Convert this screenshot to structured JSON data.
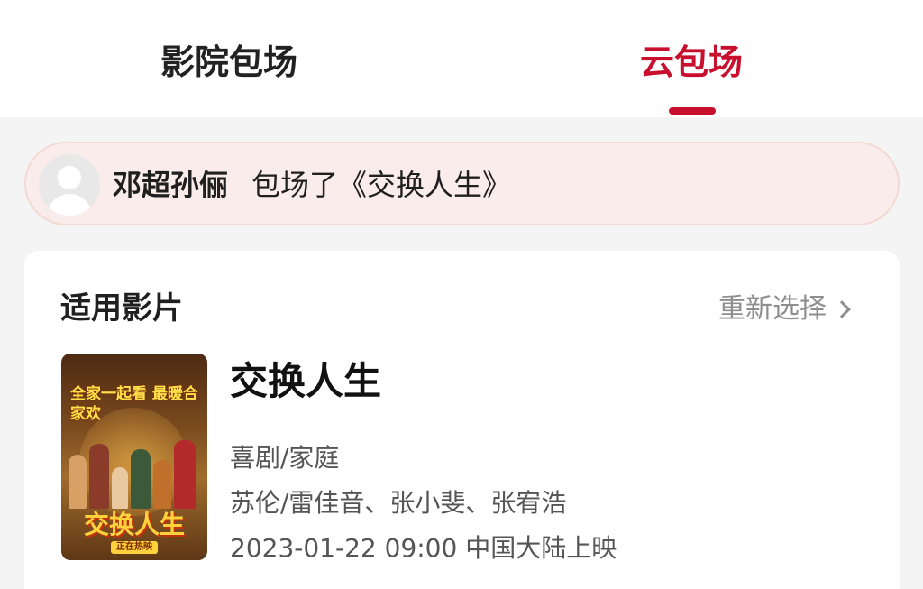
{
  "tabs": [
    {
      "label": "影院包场",
      "active": false
    },
    {
      "label": "云包场",
      "active": true
    }
  ],
  "notice": {
    "user": "邓超孙俪",
    "text": "包场了《交换人生》"
  },
  "films": {
    "title": "适用影片",
    "reselect_label": "重新选择"
  },
  "movie": {
    "poster": {
      "slogan": "全家一起看 最暖合家欢",
      "title": "交换人生",
      "status": "正在热映"
    },
    "title": "交换人生",
    "genre": "喜剧/家庭",
    "cast": "苏伦/雷佳音、张小斐、张宥浩",
    "release": "2023-01-22 09:00 中国大陆上映"
  },
  "colors": {
    "accent": "#c8102e",
    "banner_bg": "#f9ecea",
    "page_bg": "#f4f4f4"
  }
}
